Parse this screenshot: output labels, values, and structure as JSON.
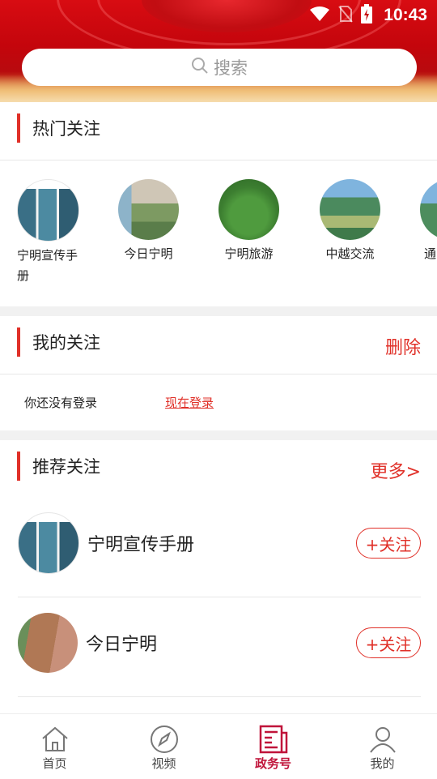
{
  "status_bar": {
    "time": "10:43"
  },
  "search": {
    "placeholder": "搜索"
  },
  "hot_follow": {
    "title": "热门关注",
    "items": [
      {
        "label": "宁明宣传手册"
      },
      {
        "label": "今日宁明"
      },
      {
        "label": "宁明旅游"
      },
      {
        "label": "中越交流"
      },
      {
        "label": "通"
      }
    ]
  },
  "my_follow": {
    "title": "我的关注",
    "action": "删除",
    "not_logged_in": "你还没有登录",
    "login_link": "现在登录"
  },
  "recommend": {
    "title": "推荐关注",
    "more": "更多>",
    "items": [
      {
        "name": "宁明宣传手册",
        "button": "+关注"
      },
      {
        "name": "今日宁明",
        "button": "+关注"
      }
    ]
  },
  "tabbar": {
    "tabs": [
      {
        "label": "首页",
        "icon": "home-icon"
      },
      {
        "label": "视频",
        "icon": "compass-icon"
      },
      {
        "label": "政务号",
        "icon": "newspaper-icon"
      },
      {
        "label": "我的",
        "icon": "user-icon"
      }
    ],
    "active_index": 2
  },
  "colors": {
    "accent": "#e03028",
    "active_tab": "#c0143a",
    "header_red": "#c4050c"
  }
}
